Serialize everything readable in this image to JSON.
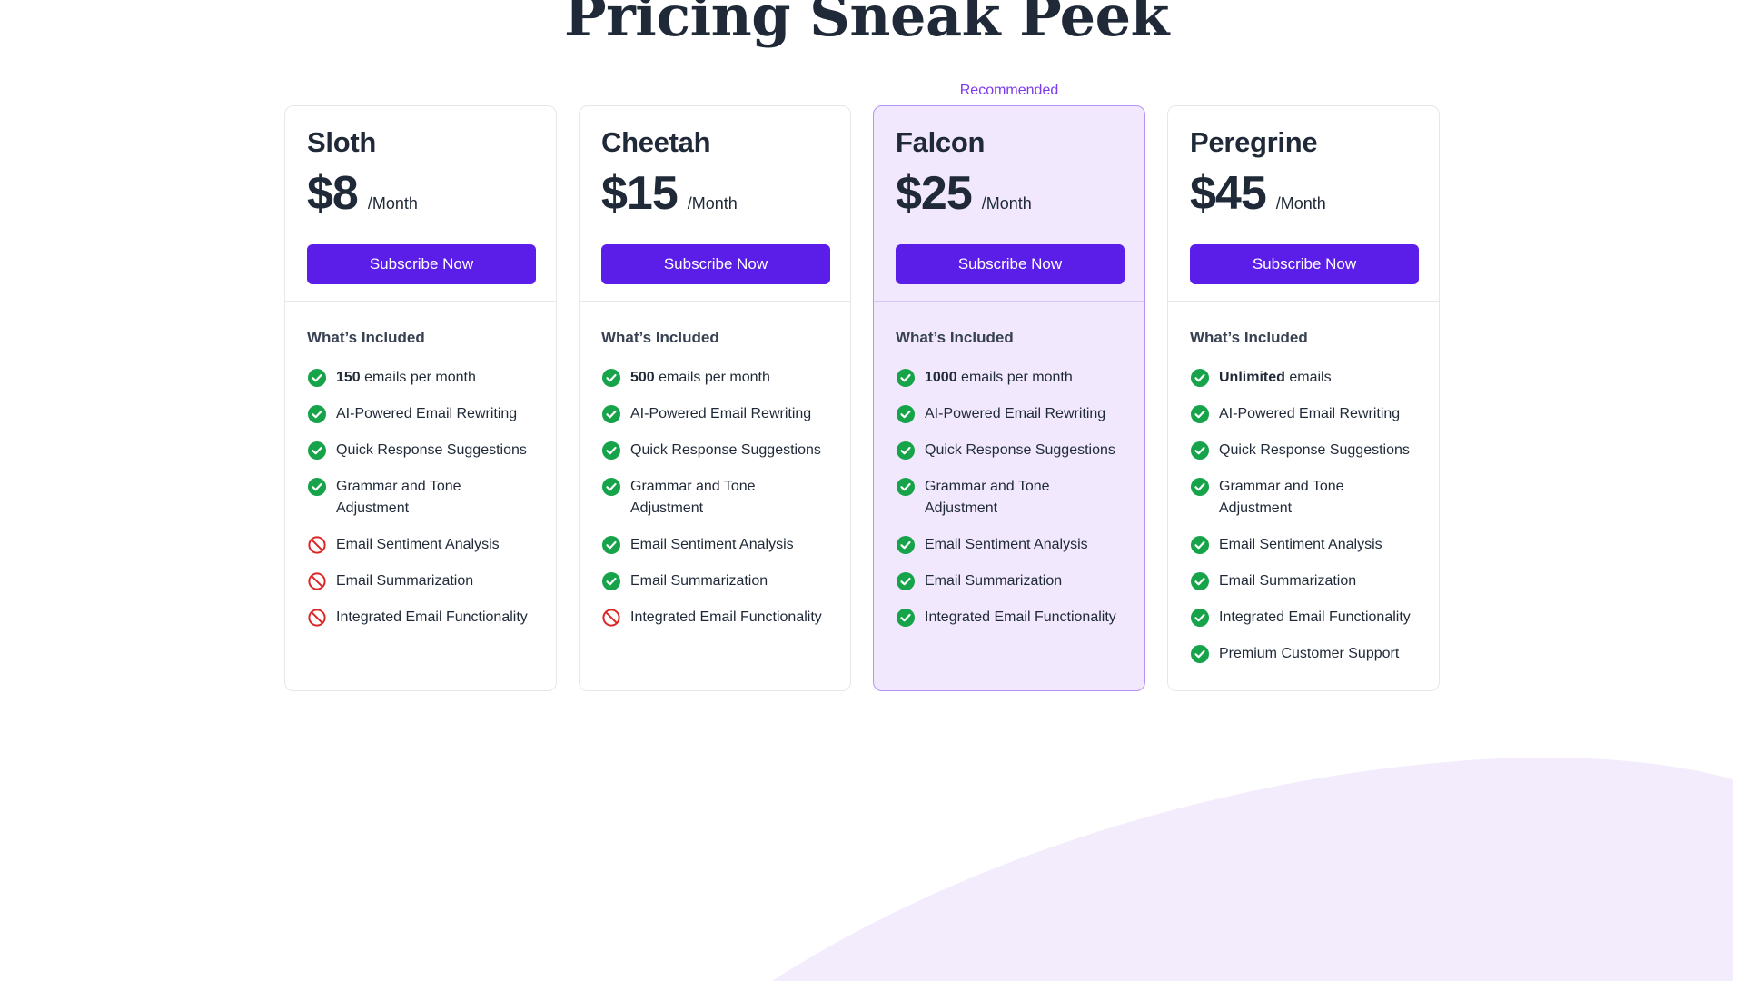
{
  "page": {
    "title": "Pricing Sneak Peek",
    "colors": {
      "accent": "#5b1ee8",
      "recommended_text": "#7c3aed",
      "featured_bg": "#f1e8fd",
      "check_green": "#16a34a",
      "excluded_red": "#dc2626",
      "blob": "#f3ecfd"
    }
  },
  "section": {
    "included_heading": "What’s Included",
    "subscribe_label": "Subscribe Now",
    "period_label": "/Month",
    "recommended_label": "Recommended"
  },
  "plans": [
    {
      "name": "Sloth",
      "price": "$8",
      "featured": false,
      "features": [
        {
          "bold": "150",
          "text": " emails per month",
          "included": true
        },
        {
          "bold": "",
          "text": "AI-Powered Email Rewriting",
          "included": true
        },
        {
          "bold": "",
          "text": "Quick Response Suggestions",
          "included": true
        },
        {
          "bold": "",
          "text": "Grammar and Tone Adjustment",
          "included": true
        },
        {
          "bold": "",
          "text": "Email Sentiment Analysis",
          "included": false
        },
        {
          "bold": "",
          "text": "Email Summarization",
          "included": false
        },
        {
          "bold": "",
          "text": "Integrated Email Functionality",
          "included": false
        }
      ]
    },
    {
      "name": "Cheetah",
      "price": "$15",
      "featured": false,
      "features": [
        {
          "bold": "500",
          "text": " emails per month",
          "included": true
        },
        {
          "bold": "",
          "text": "AI-Powered Email Rewriting",
          "included": true
        },
        {
          "bold": "",
          "text": "Quick Response Suggestions",
          "included": true
        },
        {
          "bold": "",
          "text": "Grammar and Tone Adjustment",
          "included": true
        },
        {
          "bold": "",
          "text": "Email Sentiment Analysis",
          "included": true
        },
        {
          "bold": "",
          "text": "Email Summarization",
          "included": true
        },
        {
          "bold": "",
          "text": "Integrated Email Functionality",
          "included": false
        }
      ]
    },
    {
      "name": "Falcon",
      "price": "$25",
      "featured": true,
      "features": [
        {
          "bold": "1000",
          "text": " emails per month",
          "included": true
        },
        {
          "bold": "",
          "text": "AI-Powered Email Rewriting",
          "included": true
        },
        {
          "bold": "",
          "text": "Quick Response Suggestions",
          "included": true
        },
        {
          "bold": "",
          "text": "Grammar and Tone Adjustment",
          "included": true
        },
        {
          "bold": "",
          "text": "Email Sentiment Analysis",
          "included": true
        },
        {
          "bold": "",
          "text": "Email Summarization",
          "included": true
        },
        {
          "bold": "",
          "text": "Integrated Email Functionality",
          "included": true
        }
      ]
    },
    {
      "name": "Peregrine",
      "price": "$45",
      "featured": false,
      "features": [
        {
          "bold": "Unlimited",
          "text": " emails",
          "included": true
        },
        {
          "bold": "",
          "text": "AI-Powered Email Rewriting",
          "included": true
        },
        {
          "bold": "",
          "text": "Quick Response Suggestions",
          "included": true
        },
        {
          "bold": "",
          "text": "Grammar and Tone Adjustment",
          "included": true
        },
        {
          "bold": "",
          "text": "Email Sentiment Analysis",
          "included": true
        },
        {
          "bold": "",
          "text": "Email Summarization",
          "included": true
        },
        {
          "bold": "",
          "text": "Integrated Email Functionality",
          "included": true
        },
        {
          "bold": "",
          "text": "Premium Customer Support",
          "included": true
        }
      ]
    }
  ]
}
